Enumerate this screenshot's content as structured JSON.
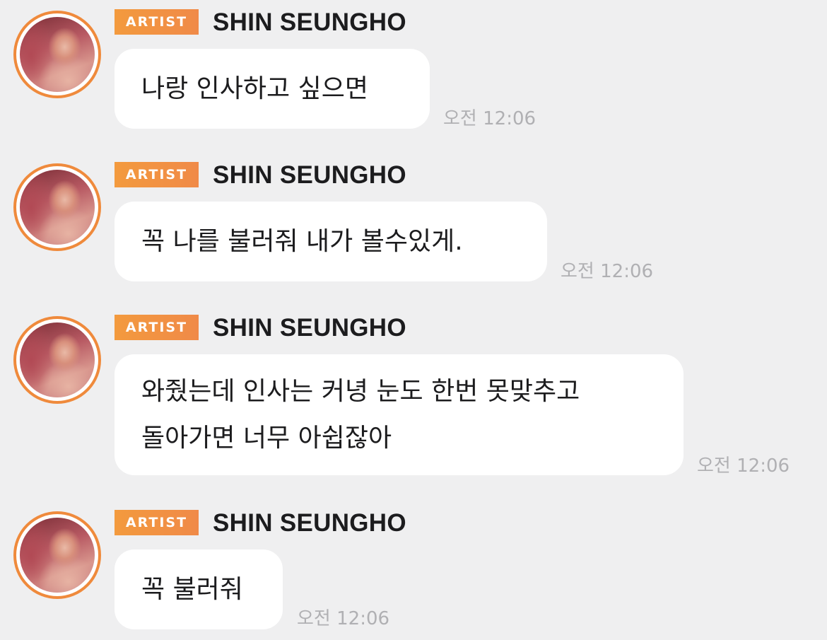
{
  "messages": [
    {
      "badge": "ARTIST",
      "sender": "SHIN SEUNGHO",
      "lines": [
        "나랑 인사하고 싶으면"
      ],
      "time": "오전 12:06"
    },
    {
      "badge": "ARTIST",
      "sender": "SHIN SEUNGHO",
      "lines": [
        "꼭 나를 불러줘 내가 볼수있게."
      ],
      "time": "오전 12:06"
    },
    {
      "badge": "ARTIST",
      "sender": "SHIN SEUNGHO",
      "lines": [
        "와줬는데 인사는 커녕 눈도 한번 못맞추고",
        "돌아가면 너무 아쉽잖아"
      ],
      "time": "오전 12:06"
    },
    {
      "badge": "ARTIST",
      "sender": "SHIN SEUNGHO",
      "lines": [
        "꼭 불러줘"
      ],
      "time": "오전 12:06"
    }
  ],
  "colors": {
    "background": "#efeff0",
    "badge": "#f39a3e",
    "avatar_ring": "#ef8a3c",
    "bubble": "#ffffff",
    "timestamp": "#b0b0b3"
  }
}
